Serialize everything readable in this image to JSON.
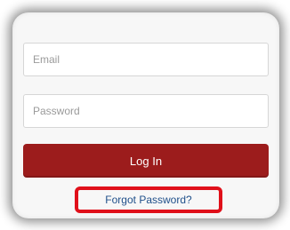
{
  "login_form": {
    "email_placeholder": "Email",
    "email_value": "",
    "password_placeholder": "Password",
    "password_value": "",
    "login_label": "Log In",
    "forgot_password_label": "Forgot Password?"
  },
  "colors": {
    "login_button": "#9c1c1c",
    "highlight_box": "#e0101a",
    "link": "#1f4f8a"
  }
}
